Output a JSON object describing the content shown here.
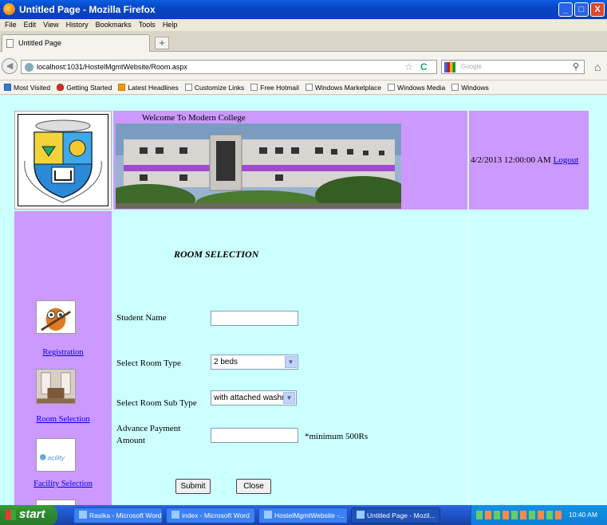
{
  "window": {
    "title": "Untitled Page - Mozilla Firefox",
    "min": "_",
    "max": "□",
    "close": "X"
  },
  "menu": [
    "File",
    "Edit",
    "View",
    "History",
    "Bookmarks",
    "Tools",
    "Help"
  ],
  "tabs": [
    {
      "label": "Untitled Page"
    }
  ],
  "newtab": "+",
  "nav": {
    "url": "localhost:1031/HostelMgmtWebsite/Room.aspx",
    "search_placeholder": "Google"
  },
  "bookmarks": [
    "Most Visited",
    "Getting Started",
    "Latest Headlines",
    "Customize Links",
    "Free Hotmail",
    "Windows Marketplace",
    "Windows Media",
    "Windows"
  ],
  "page": {
    "welcome": "Welcome To Modern College",
    "datetime": "4/2/2013 12:00:00 AM",
    "logout": "Logout",
    "sidebar": [
      {
        "label": "Registration",
        "icon": "owl-icon"
      },
      {
        "label": "Room Selection",
        "icon": "room-icon"
      },
      {
        "label": "Facility Selection",
        "icon": "facility-icon"
      }
    ],
    "heading": "ROOM SELECTION",
    "form": {
      "student_name_label": "Student Name",
      "student_name_value": "",
      "room_type_label": "Select Room Type",
      "room_type_value": "2 beds",
      "room_subtype_label": "Select Room Sub Type",
      "room_subtype_value": "with attached washrc",
      "advance_label_1": "Advance Payment",
      "advance_label_2": "Amount",
      "advance_value": "",
      "advance_note": "*minimum 500Rs",
      "submit": "Submit",
      "close": "Close"
    }
  },
  "taskbar": {
    "start": "start",
    "tasks": [
      "Rasika - Microsoft Word",
      "index - Microsoft Word",
      "HostelMgmtWebsite -...",
      "Untitled Page - Mozil..."
    ],
    "clock": "10:40 AM"
  },
  "colors": {
    "header_purple": "#cc99ff",
    "page_bg": "#ccffff",
    "link_blue": "#0000ee"
  }
}
